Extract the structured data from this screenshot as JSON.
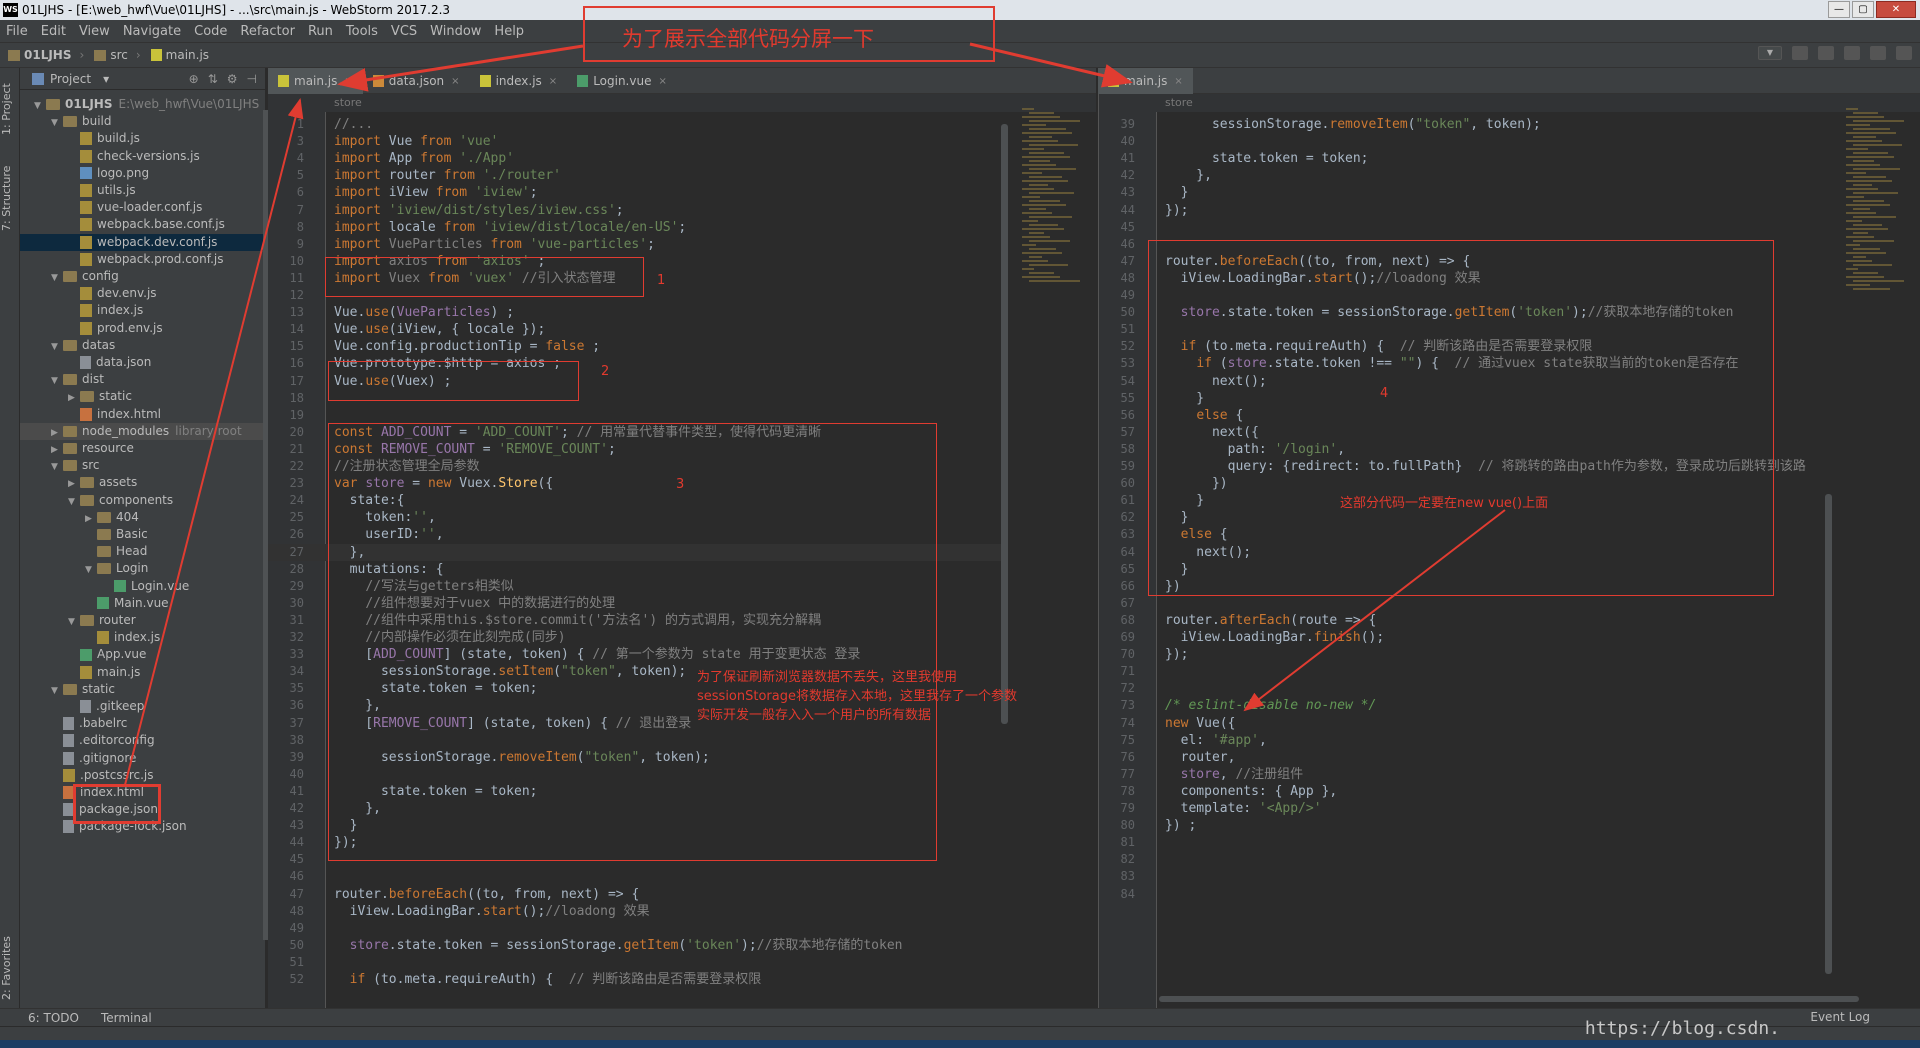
{
  "window": {
    "title": "01LJHS - [E:\\web_hwf\\Vue\\01LJHS] - ...\\src\\main.js - WebStorm 2017.2.3",
    "logo": "WS",
    "buttons": [
      "—",
      "▢",
      "✕"
    ]
  },
  "menu": [
    "File",
    "Edit",
    "View",
    "Navigate",
    "Code",
    "Refactor",
    "Run",
    "Tools",
    "VCS",
    "Window",
    "Help"
  ],
  "breadcrumb": [
    "01LJHS",
    "src",
    "main.js"
  ],
  "left_stripe": {
    "project": "1: Project",
    "structure": "7: Structure",
    "favorites": "2: Favorites"
  },
  "project_panel": {
    "title": "Project",
    "dropdown": "▾",
    "tools": [
      "⊕",
      "⇅",
      "⚙",
      "⊣"
    ],
    "tree": [
      {
        "label": "01LJHS",
        "extra": "E:\\web_hwf\\Vue\\01LJHS",
        "icon": "folder",
        "depth": 0,
        "arrow": "▼",
        "bold": true
      },
      {
        "label": "build",
        "icon": "folder",
        "depth": 1,
        "arrow": "▼"
      },
      {
        "label": "build.js",
        "icon": "js",
        "depth": 2
      },
      {
        "label": "check-versions.js",
        "icon": "js",
        "depth": 2
      },
      {
        "label": "logo.png",
        "icon": "img",
        "depth": 2
      },
      {
        "label": "utils.js",
        "icon": "js",
        "depth": 2
      },
      {
        "label": "vue-loader.conf.js",
        "icon": "js",
        "depth": 2
      },
      {
        "label": "webpack.base.conf.js",
        "icon": "js",
        "depth": 2
      },
      {
        "label": "webpack.dev.conf.js",
        "icon": "js",
        "depth": 2,
        "selected": true
      },
      {
        "label": "webpack.prod.conf.js",
        "icon": "js",
        "depth": 2
      },
      {
        "label": "config",
        "icon": "folder",
        "depth": 1,
        "arrow": "▼"
      },
      {
        "label": "dev.env.js",
        "icon": "js",
        "depth": 2
      },
      {
        "label": "index.js",
        "icon": "js",
        "depth": 2
      },
      {
        "label": "prod.env.js",
        "icon": "js",
        "depth": 2
      },
      {
        "label": "datas",
        "icon": "folder",
        "depth": 1,
        "arrow": "▼"
      },
      {
        "label": "data.json",
        "icon": "file",
        "depth": 2
      },
      {
        "label": "dist",
        "icon": "folder",
        "depth": 1,
        "arrow": "▼"
      },
      {
        "label": "static",
        "icon": "folder",
        "depth": 2,
        "arrow": "▶"
      },
      {
        "label": "index.html",
        "icon": "html",
        "depth": 2
      },
      {
        "label": "node_modules",
        "extra": "library root",
        "icon": "folder",
        "depth": 1,
        "arrow": "▶",
        "hl": true
      },
      {
        "label": "resource",
        "icon": "folder",
        "depth": 1,
        "arrow": "▶"
      },
      {
        "label": "src",
        "icon": "folder",
        "depth": 1,
        "arrow": "▼"
      },
      {
        "label": "assets",
        "icon": "folder",
        "depth": 2,
        "arrow": "▶"
      },
      {
        "label": "components",
        "icon": "folder",
        "depth": 2,
        "arrow": "▼"
      },
      {
        "label": "404",
        "icon": "folder",
        "depth": 3,
        "arrow": "▶"
      },
      {
        "label": "Basic",
        "icon": "folder",
        "depth": 3
      },
      {
        "label": "Head",
        "icon": "folder",
        "depth": 3
      },
      {
        "label": "Login",
        "icon": "folder",
        "depth": 3,
        "arrow": "▼"
      },
      {
        "label": "Login.vue",
        "icon": "vue",
        "depth": 4
      },
      {
        "label": "Main.vue",
        "icon": "vue",
        "depth": 3
      },
      {
        "label": "router",
        "icon": "folder",
        "depth": 2,
        "arrow": "▼"
      },
      {
        "label": "index.js",
        "icon": "js",
        "depth": 3
      },
      {
        "label": "App.vue",
        "icon": "vue",
        "depth": 2
      },
      {
        "label": "main.js",
        "icon": "js",
        "depth": 2
      },
      {
        "label": "static",
        "icon": "folder",
        "depth": 1,
        "arrow": "▼"
      },
      {
        "label": ".gitkeep",
        "icon": "file",
        "depth": 2
      },
      {
        "label": ".babelrc",
        "icon": "file",
        "depth": 1
      },
      {
        "label": ".editorconfig",
        "icon": "file",
        "depth": 1
      },
      {
        "label": ".gitignore",
        "icon": "file",
        "depth": 1
      },
      {
        "label": ".postcssrc.js",
        "icon": "js",
        "depth": 1
      },
      {
        "label": "index.html",
        "icon": "html",
        "depth": 1
      },
      {
        "label": "package.json",
        "icon": "file",
        "depth": 1
      },
      {
        "label": "package-lock.json",
        "icon": "file",
        "depth": 1
      }
    ]
  },
  "tabs_left": [
    {
      "label": "main.js",
      "icon": "js",
      "active": true
    },
    {
      "label": "data.json",
      "icon": "json"
    },
    {
      "label": "index.js",
      "icon": "js"
    },
    {
      "label": "Login.vue",
      "icon": "vue"
    }
  ],
  "tabs_right": [
    {
      "label": "main.js",
      "icon": "js",
      "active": true
    }
  ],
  "tab_close": "×",
  "editor_crumb": "store",
  "left_code": [
    {
      "n": "1",
      "h": "<span class=\"c\">//...</span>"
    },
    {
      "n": "3",
      "h": "<span class=\"k\">import</span> Vue <span class=\"k\">from</span> <span class=\"s\">'vue'</span>"
    },
    {
      "n": "4",
      "h": "<span class=\"k\">import</span> App <span class=\"k\">from</span> <span class=\"s\">'./App'</span>"
    },
    {
      "n": "5",
      "h": "<span class=\"k\">import</span> router <span class=\"k\">from</span> <span class=\"s\">'./router'</span>"
    },
    {
      "n": "6",
      "h": "<span class=\"k\">import</span> iView <span class=\"k\">from</span> <span class=\"s\">'iview'</span>;"
    },
    {
      "n": "7",
      "h": "<span class=\"k\">import</span> <span class=\"s\">'iview/dist/styles/iview.css'</span>;"
    },
    {
      "n": "8",
      "h": "<span class=\"k\">import</span> locale <span class=\"k\">from</span> <span class=\"s\">'iview/dist/locale/en-US'</span>;"
    },
    {
      "n": "9",
      "h": "<span class=\"k\">import</span> <span class=\"c\">VueParticles</span> <span class=\"k\">from</span> <span class=\"s\">'vue-particles'</span>;"
    },
    {
      "n": "10",
      "h": "<span class=\"k\">import</span> <span class=\"c\">axios</span> <span class=\"k\">from</span> <span class=\"s\">'axios'</span> ;"
    },
    {
      "n": "11",
      "h": "<span class=\"k\">import</span> <span class=\"c\">Vuex</span> <span class=\"k\">from</span> <span class=\"s\">'vuex'</span> <span class=\"c\">//引入状态管理</span>"
    },
    {
      "n": "12",
      "h": ""
    },
    {
      "n": "13",
      "h": "Vue.<span class=\"k\">use</span>(<span class=\"p\">VueParticles</span>) ;"
    },
    {
      "n": "14",
      "h": "Vue.<span class=\"k\">use</span>(iView, { locale });"
    },
    {
      "n": "15",
      "h": "Vue.config.productionTip = <span class=\"k\">false</span> ;"
    },
    {
      "n": "16",
      "h": "Vue.prototype.$http = axios ;"
    },
    {
      "n": "17",
      "h": "Vue.<span class=\"k\">use</span>(Vuex) ;"
    },
    {
      "n": "18",
      "h": ""
    },
    {
      "n": "19",
      "h": ""
    },
    {
      "n": "20",
      "h": "<span class=\"k\">const</span> <span class=\"p\">ADD_COUNT</span> = <span class=\"s\">'ADD_COUNT'</span>; <span class=\"c\">// 用常量代替事件类型，使得代码更清晰</span>"
    },
    {
      "n": "21",
      "h": "<span class=\"k\">const</span> <span class=\"p\">REMOVE_COUNT</span> = <span class=\"s\">'REMOVE_COUNT'</span>;"
    },
    {
      "n": "22",
      "h": "<span class=\"c\">//注册状态管理全局参数</span>"
    },
    {
      "n": "23",
      "h": "<span class=\"k\">var</span> <span class=\"p\">store</span> = <span class=\"k\">new</span> Vuex.<span class=\"fn\">Store</span>({"
    },
    {
      "n": "24",
      "h": "  state:{"
    },
    {
      "n": "25",
      "h": "    token:<span class=\"s\">''</span>,"
    },
    {
      "n": "26",
      "h": "    userID:<span class=\"s\">''</span>,"
    },
    {
      "n": "27",
      "h": "  },",
      "cur": true
    },
    {
      "n": "28",
      "h": "  mutations: {"
    },
    {
      "n": "29",
      "h": "    <span class=\"c\">//写法与getters相类似</span>"
    },
    {
      "n": "30",
      "h": "    <span class=\"c\">//组件想要对于vuex 中的数据进行的处理</span>"
    },
    {
      "n": "31",
      "h": "    <span class=\"c\">//组件中采用this.$store.commit('方法名') 的方式调用，实现充分解耦</span>"
    },
    {
      "n": "32",
      "h": "    <span class=\"c\">//内部操作必须在此刻完成(同步)</span>"
    },
    {
      "n": "33",
      "h": "    [<span class=\"p\">ADD_COUNT</span>] (state, token) { <span class=\"c\">// 第一个参数为 state 用于变更状态 登录</span>"
    },
    {
      "n": "34",
      "h": "      sessionStorage.<span class=\"k\">setItem</span>(<span class=\"s\">\"token\"</span>, token);"
    },
    {
      "n": "35",
      "h": "      state.token = token;"
    },
    {
      "n": "36",
      "h": "    },"
    },
    {
      "n": "37",
      "h": "    [<span class=\"p\">REMOVE_COUNT</span>] (state, token) { <span class=\"c\">// 退出登录</span>"
    },
    {
      "n": "38",
      "h": ""
    },
    {
      "n": "39",
      "h": "      sessionStorage.<span class=\"k\">removeItem</span>(<span class=\"s\">\"token\"</span>, token);"
    },
    {
      "n": "40",
      "h": ""
    },
    {
      "n": "41",
      "h": "      state.token = token;"
    },
    {
      "n": "42",
      "h": "    },"
    },
    {
      "n": "43",
      "h": "  }"
    },
    {
      "n": "44",
      "h": "});"
    },
    {
      "n": "45",
      "h": ""
    },
    {
      "n": "46",
      "h": ""
    },
    {
      "n": "47",
      "h": "router.<span class=\"k\">beforeEach</span>((to, from, next) => {"
    },
    {
      "n": "48",
      "h": "  iView.LoadingBar.<span class=\"k\">start</span>();<span class=\"c\">//loadong 效果</span>"
    },
    {
      "n": "49",
      "h": ""
    },
    {
      "n": "50",
      "h": "  <span class=\"p\">store</span>.state.token = sessionStorage.<span class=\"k\">getItem</span>(<span class=\"s\">'token'</span>);<span class=\"c\">//获取本地存储的token</span>"
    },
    {
      "n": "51",
      "h": ""
    },
    {
      "n": "52",
      "h": "  <span class=\"k\">if</span> (to.meta.requireAuth) {  <span class=\"c\">// 判断该路由是否需要登录权限</span>"
    }
  ],
  "right_code": [
    {
      "n": "39",
      "h": "      sessionStorage.<span class=\"k\">removeItem</span>(<span class=\"s\">\"token\"</span>, token);"
    },
    {
      "n": "40",
      "h": ""
    },
    {
      "n": "41",
      "h": "      state.token = token;"
    },
    {
      "n": "42",
      "h": "    },"
    },
    {
      "n": "43",
      "h": "  }"
    },
    {
      "n": "44",
      "h": "});"
    },
    {
      "n": "45",
      "h": ""
    },
    {
      "n": "46",
      "h": ""
    },
    {
      "n": "47",
      "h": "router.<span class=\"k\">beforeEach</span>((to, from, next) => {"
    },
    {
      "n": "48",
      "h": "  iView.LoadingBar.<span class=\"k\">start</span>();<span class=\"c\">//loadong 效果</span>"
    },
    {
      "n": "49",
      "h": ""
    },
    {
      "n": "50",
      "h": "  <span class=\"p\">store</span>.state.token = sessionStorage.<span class=\"k\">getItem</span>(<span class=\"s\">'token'</span>);<span class=\"c\">//获取本地存储的token</span>"
    },
    {
      "n": "51",
      "h": ""
    },
    {
      "n": "52",
      "h": "  <span class=\"k\">if</span> (to.meta.requireAuth) {  <span class=\"c\">// 判断该路由是否需要登录权限</span>"
    },
    {
      "n": "53",
      "h": "    <span class=\"k\">if</span> (<span class=\"p\">store</span>.state.token !== <span class=\"s\">\"\"</span>) {  <span class=\"c\">// 通过vuex state获取当前的token是否存在</span>"
    },
    {
      "n": "54",
      "h": "      next();"
    },
    {
      "n": "55",
      "h": "    }"
    },
    {
      "n": "56",
      "h": "    <span class=\"k\">else</span> {"
    },
    {
      "n": "57",
      "h": "      next({"
    },
    {
      "n": "58",
      "h": "        path: <span class=\"s\">'/login'</span>,"
    },
    {
      "n": "59",
      "h": "        query: {redirect: to.fullPath}  <span class=\"c\">// 将跳转的路由path作为参数，登录成功后跳转到该路</span>"
    },
    {
      "n": "60",
      "h": "      })"
    },
    {
      "n": "61",
      "h": "    }"
    },
    {
      "n": "62",
      "h": "  }"
    },
    {
      "n": "63",
      "h": "  <span class=\"k\">else</span> {"
    },
    {
      "n": "64",
      "h": "    next();"
    },
    {
      "n": "65",
      "h": "  }"
    },
    {
      "n": "66",
      "h": "})"
    },
    {
      "n": "67",
      "h": ""
    },
    {
      "n": "68",
      "h": "router.<span class=\"k\">afterEach</span>(route => {"
    },
    {
      "n": "69",
      "h": "  iView.LoadingBar.<span class=\"k\">finish</span>();"
    },
    {
      "n": "70",
      "h": "});"
    },
    {
      "n": "71",
      "h": ""
    },
    {
      "n": "72",
      "h": ""
    },
    {
      "n": "73",
      "h": "<span class=\"ci\">/* eslint-disable no-new */</span>"
    },
    {
      "n": "74",
      "h": "<span class=\"k\">new</span> Vue({"
    },
    {
      "n": "75",
      "h": "  el: <span class=\"s\">'#app'</span>,"
    },
    {
      "n": "76",
      "h": "  router,"
    },
    {
      "n": "77",
      "h": "  <span class=\"p\">store</span>, <span class=\"c\">//注册组件</span>"
    },
    {
      "n": "78",
      "h": "  components: { App },"
    },
    {
      "n": "79",
      "h": "  template: <span class=\"s\">'&lt;App/&gt;'</span>"
    },
    {
      "n": "80",
      "h": "}) ;"
    },
    {
      "n": "81",
      "h": ""
    },
    {
      "n": "82",
      "h": ""
    },
    {
      "n": "83",
      "h": ""
    },
    {
      "n": "84",
      "h": ""
    }
  ],
  "annotations": {
    "title_note": "为了展示全部代码分屏一下",
    "n1": "1",
    "n2": "2",
    "n3": "3",
    "n4": "4",
    "note_storage": [
      "为了保证刷新浏览器数据不丢失，这里我使用",
      "sessionStorage将数据存入本地，这里我存了一个参数",
      "实际开发一般存入入一个用户的所有数据"
    ],
    "note_before_vue": "这部分代码一定要在new vue()上面",
    "color": "#e03c31"
  },
  "statusbar": {
    "todo": "6: TODO",
    "terminal": "Terminal",
    "event_log": "Event Log"
  },
  "watermark": "https://blog.csdn.",
  "colors": {
    "background": "#2b2b2b",
    "panel": "#3c3f41",
    "keyword": "#cc7832",
    "string": "#6a8759",
    "comment": "#808080"
  }
}
